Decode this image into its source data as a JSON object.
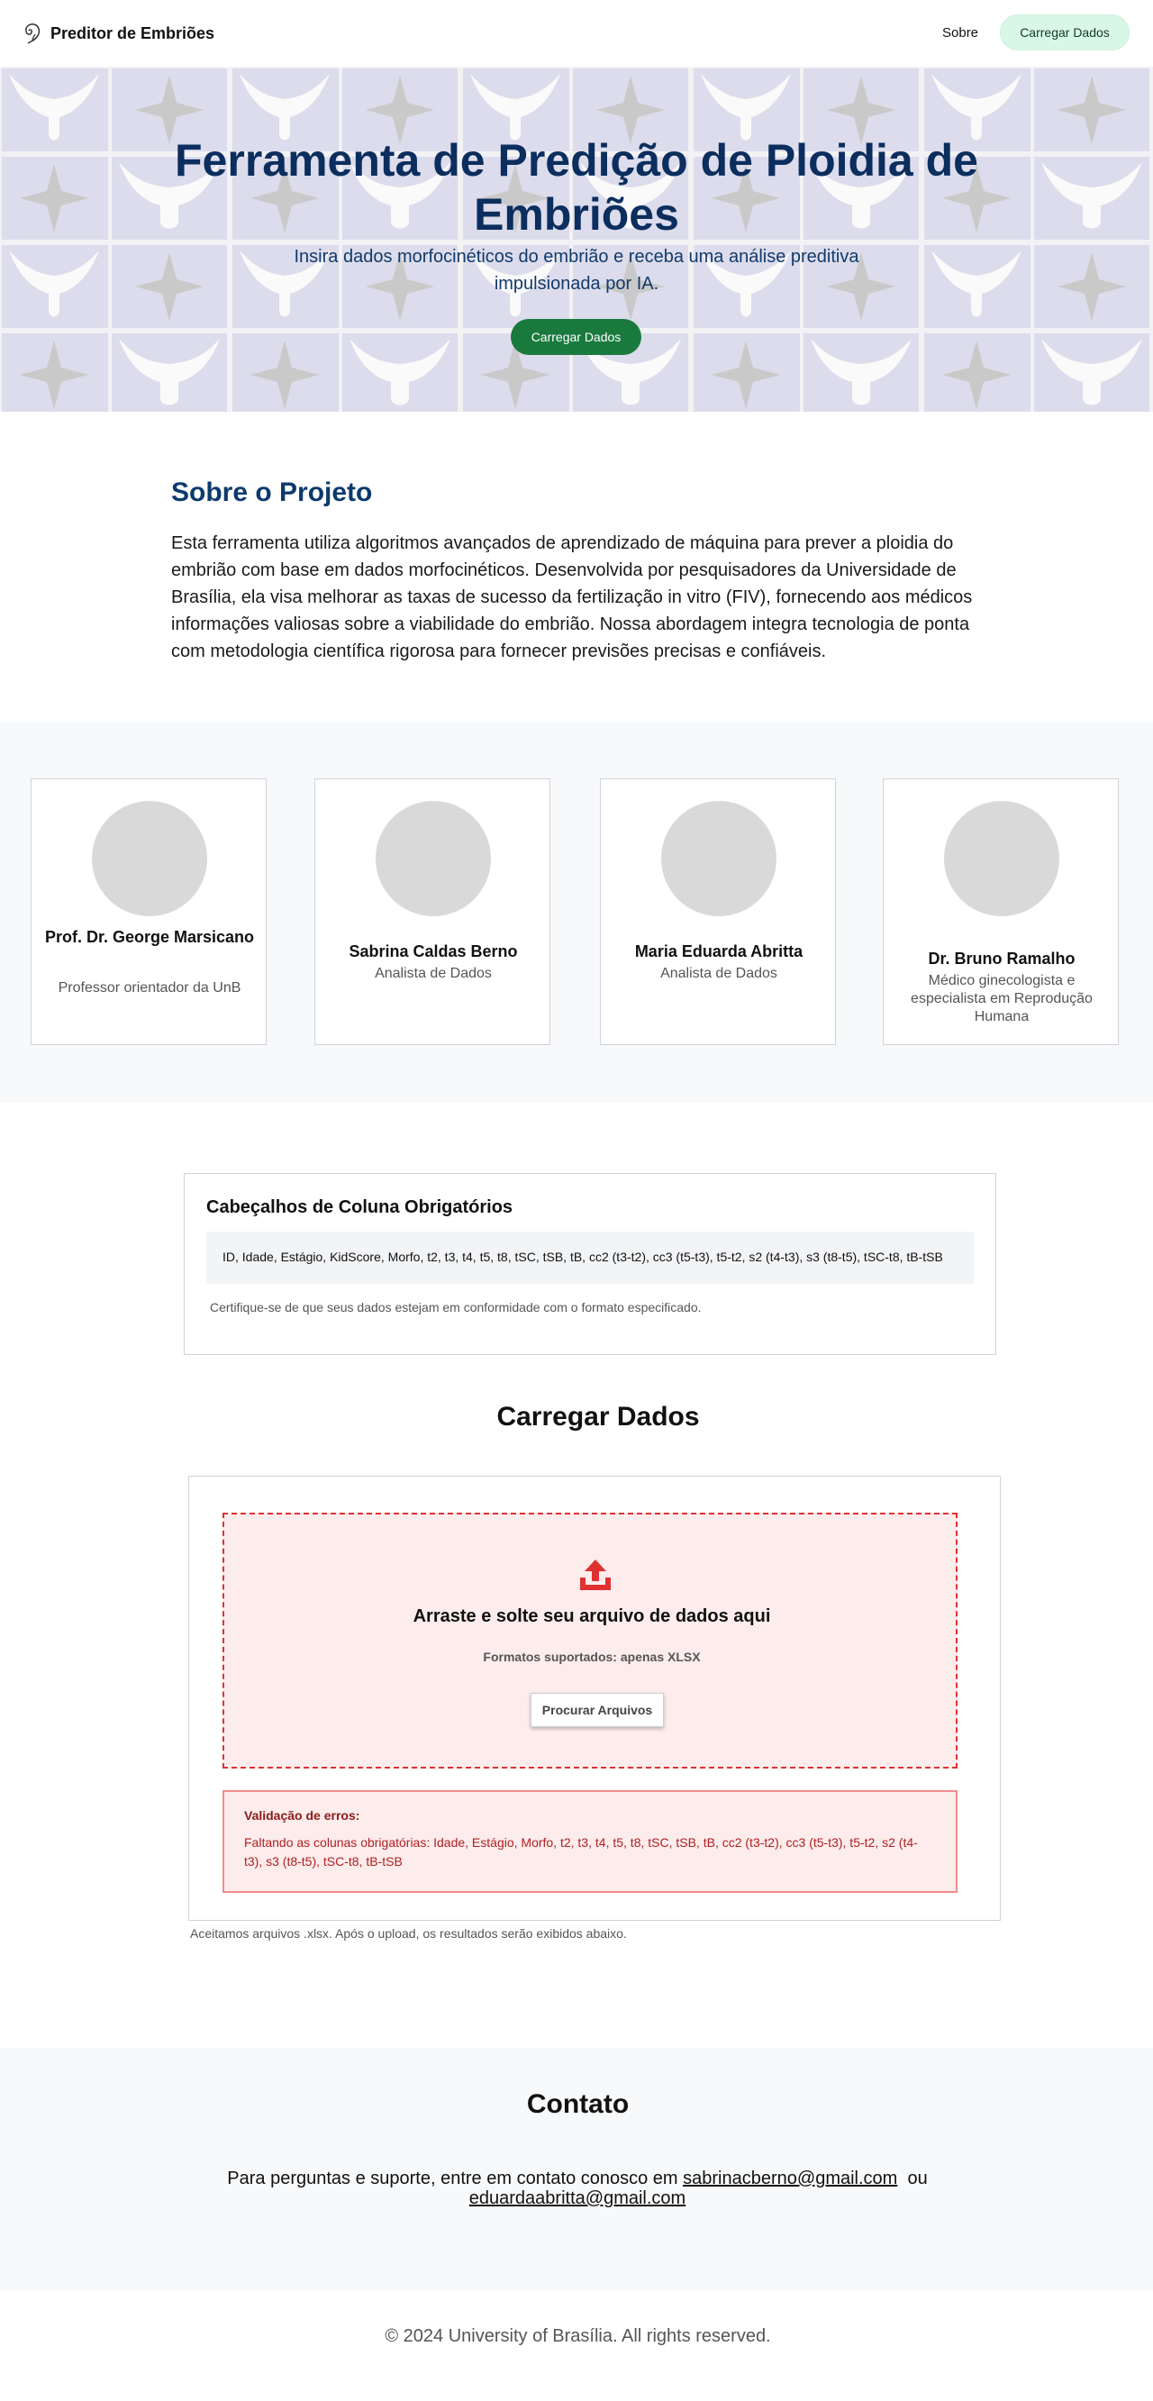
{
  "nav": {
    "brand": "Preditor de Embriões",
    "brand_icon": "embryo-icon",
    "links": [
      "Sobre"
    ],
    "cta": "Carregar Dados"
  },
  "hero": {
    "title": "Ferramenta de Predição de Ploidia de Embriões",
    "subtitle": "Insira dados morfocinéticos do embrião e receba uma análise preditiva impulsionada por IA.",
    "button": "Carregar Dados"
  },
  "about": {
    "title": "Sobre o Projeto",
    "text": "Esta ferramenta utiliza algoritmos avançados de aprendizado de máquina para prever a ploidia do embrião com base em dados morfocinéticos. Desenvolvida por pesquisadores da Universidade de Brasília, ela visa melhorar as taxas de sucesso da fertilização in vitro (FIV), fornecendo aos médicos informações valiosas sobre a viabilidade do embrião. Nossa abordagem integra tecnologia de ponta com metodologia científica rigorosa para fornecer previsões precisas e confiáveis."
  },
  "team": [
    {
      "name": "Prof. Dr. George Marsicano",
      "role": "Professor orientador da UnB"
    },
    {
      "name": "Sabrina Caldas Berno",
      "role": "Analista de Dados"
    },
    {
      "name": "Maria Eduarda Abritta",
      "role": "Analista de Dados"
    },
    {
      "name": "Dr. Bruno Ramalho",
      "role": "Médico ginecologista e especialista em Reprodução Humana"
    }
  ],
  "required": {
    "title": "Cabeçalhos de Coluna Obrigatórios",
    "columns": "ID, Idade, Estágio, KidScore, Morfo, t2, t3, t4, t5, t8, tSC, tSB, tB, cc2 (t3-t2), cc3 (t5-t3), t5-t2, s2 (t4-t3), s3 (t8-t5), tSC-t8, tB-tSB",
    "note": "Certifique-se de que seus dados estejam em conformidade com o formato especificado."
  },
  "upload": {
    "title": "Carregar Dados",
    "icon": "upload-icon",
    "drop_title": "Arraste e solte seu arquivo de dados aqui",
    "formats": "Formatos suportados: apenas XLSX",
    "browse": "Procurar Arquivos",
    "error_title": "Validação de erros:",
    "error_text": "Faltando as colunas obrigatórias: Idade, Estágio, Morfo, t2, t3, t4, t5, t8, tSC, tSB, tB, cc2 (t3-t2), cc3 (t5-t3), t5-t2, s2 (t4-t3), s3 (t8-t5), tSC-t8, tB-tSB",
    "note": "Aceitamos arquivos .xlsx. Após o upload, os resultados serão exibidos abaixo."
  },
  "contact": {
    "title": "Contato",
    "text": "Para perguntas e suporte, entre em contato conosco em",
    "email1": "sabrinacberno@gmail.com",
    "separator": "ou",
    "email2": "eduardaabritta@gmail.com"
  },
  "footer": "© 2024 University of Brasília. All rights reserved.",
  "colors": {
    "hero_title": "#0b2e5e",
    "primary_green": "#1a7a3e",
    "error_red": "#e03131"
  }
}
